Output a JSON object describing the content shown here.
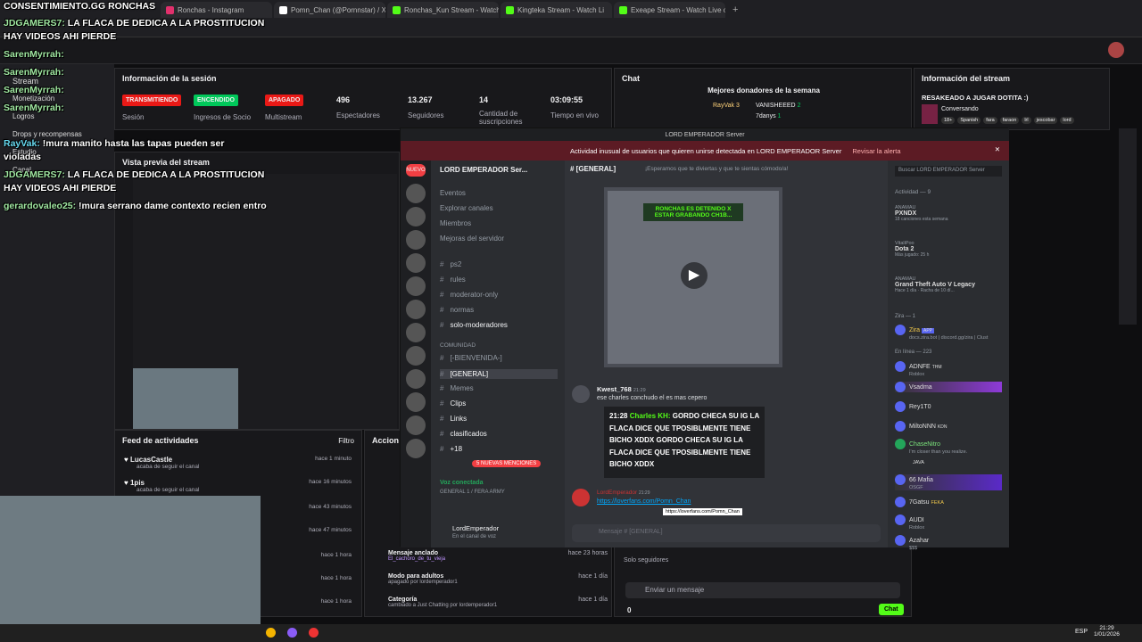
{
  "browser": {
    "tabs": [
      {
        "label": "Ronchas - Instagram",
        "color": "#e1306c"
      },
      {
        "label": "Pomn_Chan (@Pornnstar) / X",
        "color": "#ffffff"
      },
      {
        "label": "Ronchas_Kun Stream - Watch L",
        "color": "#53fc18"
      },
      {
        "label": "Kingteka Stream - Watch Li",
        "color": "#53fc18"
      },
      {
        "label": "Exeape Stream - Watch Live o",
        "color": "#53fc18"
      }
    ]
  },
  "overlay_chat": [
    {
      "user": "CONSENTIMIENTO.GG RONCHAS",
      "text": ""
    },
    {
      "user": "JDGAMERS7:",
      "text": "LA FLACA DE DEDICA A LA PROSTITUCION"
    },
    {
      "user": "",
      "text": "HAY VIDEOS AHI PIERDE"
    },
    {
      "user": "SarenMyrrah:",
      "text": ""
    },
    {
      "user": "SarenMyrrah:",
      "text": ""
    },
    {
      "user": "SarenMyrrah:",
      "text": ""
    },
    {
      "user": "SarenMyrrah:",
      "text": ""
    },
    {
      "user": "RayVak:",
      "text": "!mura manito hasta las tapas pueden ser"
    },
    {
      "user": "",
      "text": "violadas"
    },
    {
      "user": "JDGAMERS7:",
      "text": "LA FLACA DE DEDICA A LA PROSTITUCION"
    },
    {
      "user": "",
      "text": "HAY VIDEOS AHI PIERDE"
    },
    {
      "user": "gerardovaleo25:",
      "text": "!mura serrano dame contexto recien entro"
    }
  ],
  "left_nav": [
    "Stream",
    "Monetización",
    "Logros",
    "Drops y recompensas",
    "Estudio",
    "Canal"
  ],
  "session": {
    "title": "Información de la sesión",
    "badges": [
      {
        "label": "TRANSMITIENDO",
        "color": "#e91916",
        "caption": "Sesión"
      },
      {
        "label": "ENCENDIDO",
        "color": "#00c85a",
        "caption": "Ingresos de Socio"
      },
      {
        "label": "APAGADO",
        "color": "#e91916",
        "caption": "Multistream"
      }
    ],
    "stats": [
      {
        "value": "496",
        "label": "Espectadores"
      },
      {
        "value": "13.267",
        "label": "Seguidores"
      },
      {
        "value": "14",
        "label": "Cantidad de suscripciones"
      },
      {
        "value": "03:09:55",
        "label": "Tiempo en vivo"
      }
    ]
  },
  "chat_panel": {
    "title": "Chat",
    "donors_title": "Mejores donadores de la semana",
    "donors": [
      {
        "name": "RayVak",
        "amount": "3"
      },
      {
        "name": "VANISHEEED",
        "amount": "2"
      },
      {
        "name": "7danys",
        "amount": "1"
      }
    ],
    "only_followers": "Solo seguidores",
    "input_placeholder": "Enviar un mensaje",
    "points": "0",
    "send_label": "Chat"
  },
  "stream_info": {
    "title": "Información del stream",
    "stream_title": "RESAKEADO A JUGAR DOTITA :)",
    "category": "Conversando",
    "tags": [
      "18+",
      "Spanish",
      "fara",
      "faraon",
      "lrl",
      "jescobar",
      "lord"
    ]
  },
  "preview": {
    "title": "Vista previa del stream"
  },
  "feed": {
    "title": "Feed de actividades",
    "filter": "Filtro",
    "items": [
      {
        "user": "LucasCastle",
        "sub": "acaba de seguir el canal",
        "time": "hace 1 minuto"
      },
      {
        "user": "1pis",
        "sub": "acaba de seguir el canal",
        "time": "hace 16 minutos"
      },
      {
        "user": "",
        "sub": "",
        "time": "hace 43 minutos"
      },
      {
        "user": "",
        "sub": "",
        "time": "hace 47 minutos"
      },
      {
        "user": "",
        "sub": "",
        "time": "hace 1 hora"
      },
      {
        "user": "",
        "sub": "",
        "time": "hace 1 hora"
      },
      {
        "user": "",
        "sub": "",
        "time": "hace 1 hora"
      }
    ]
  },
  "actions": {
    "title": "Accion",
    "items": [
      {
        "label": "Mensaje anclado",
        "sub": "El_cachoro_de_tu_vieja",
        "time": "hace 23 horas"
      },
      {
        "label": "Modo para adultos",
        "sub": "apagado por lordemperador1",
        "time": "hace 1 día"
      },
      {
        "label": "Categoría",
        "sub": "cambiado a Just Chatting por lordemperador1",
        "time": "hace 1 día"
      }
    ]
  },
  "discord": {
    "window_title": "LORD EMPERADOR Server",
    "alert": "Actividad inusual de usuarios que quieren unirse detectada en LORD EMPERADOR Server",
    "alert_link": "Revisar la alerta",
    "server_name": "LORD EMPERADOR Ser...",
    "channel_header": "[GENERAL]",
    "channel_topic": "¡Esperamos que te diviertas y que te sientas cómodo/a!",
    "search_placeholder": "Buscar LORD EMPERADOR Server",
    "nav": [
      "Eventos",
      "Explorar canales",
      "Miembros",
      "Mejoras del servidor"
    ],
    "channels": [
      "ps2",
      "rules",
      "moderator-only",
      "normas",
      "solo-moderadores"
    ],
    "category": "COMUNIDAD",
    "community": [
      "[-BIENVENIDA-]",
      "[GENERAL]",
      "Memes",
      "Clips",
      "Links",
      "clasificados",
      "+18"
    ],
    "new_mentions": "5 NUEVAS MENCIONES",
    "voice": {
      "status": "Voz conectada",
      "channel": "GENERAL 1 / FERA ARMY"
    },
    "user": {
      "name": "LordEmperador",
      "status": "En el canal de voz"
    },
    "video_caption": "RONCHAS ES DETENIDO X ESTAR GRABANDO CH1B...",
    "msg1": {
      "author": "Kwest_768",
      "time": "21:29",
      "text": "ese charles conchudo el es mas cepero"
    },
    "quote": {
      "time": "21:28",
      "author": "Charles KH:",
      "text": "GORDO CHECA SU IG LA FLACA DICE QUE TPOSIBLMENTE TIENE BICHO XDDX",
      "text2": "GORDO CHECA SU IG LA FLACA DICE QUE TPOSIBLMENTE TIENE BICHO XDDX"
    },
    "msg2": {
      "author": "LordEmperador",
      "time": "21:29",
      "link": "https://loverfans.com/Pomn_Chan",
      "tooltip": "https://loverfans.com/Pomn_Chan"
    },
    "composer_placeholder": "Mensaje # [GENERAL]",
    "activity_header": "Actividad — 9",
    "activity": [
      {
        "user": "ANAMAU",
        "title": "PXNDX",
        "sub": "18 canciones esta semana"
      },
      {
        "user": "VitaliPoo",
        "title": "Dota 2",
        "sub": "Más jugado: 25 h"
      },
      {
        "user": "ANAMAU",
        "title": "Grand Theft Auto V Legacy",
        "sub": "Hace 1 día · Racha de 10 dí..."
      }
    ],
    "zira_header": "Zira — 1",
    "zira": {
      "name": "Zira",
      "tag": "APP",
      "sub": "docs.zira.bot | discord.gg/zira | Clust"
    },
    "online_header": "En línea — 223",
    "members": [
      {
        "name": "ADNFE",
        "tag": "THM",
        "sub": "Roblox"
      },
      {
        "name": "Vsadma",
        "tag": "",
        "sub": ""
      },
      {
        "name": "Rey1T0",
        "tag": "",
        "sub": ""
      },
      {
        "name": "MiltoNNN",
        "tag": "KDN",
        "sub": ""
      },
      {
        "name": "ChaseNitro",
        "tag": "",
        "sub": "I'm closer than you realize."
      },
      {
        "name": "JAVA",
        "tag": "",
        "sub": ""
      },
      {
        "name": "66 Mafia",
        "tag": "",
        "sub": "OSGF"
      },
      {
        "name": "7Gatsu",
        "tag": "FEKA",
        "sub": ""
      },
      {
        "name": "AUDI",
        "tag": "",
        "sub": "Roblox"
      },
      {
        "name": "Azahar",
        "tag": "",
        "sub": "$$$"
      }
    ]
  },
  "taskbar": {
    "time": "21:29",
    "date": "1/01/2026",
    "lang": "ESP"
  }
}
